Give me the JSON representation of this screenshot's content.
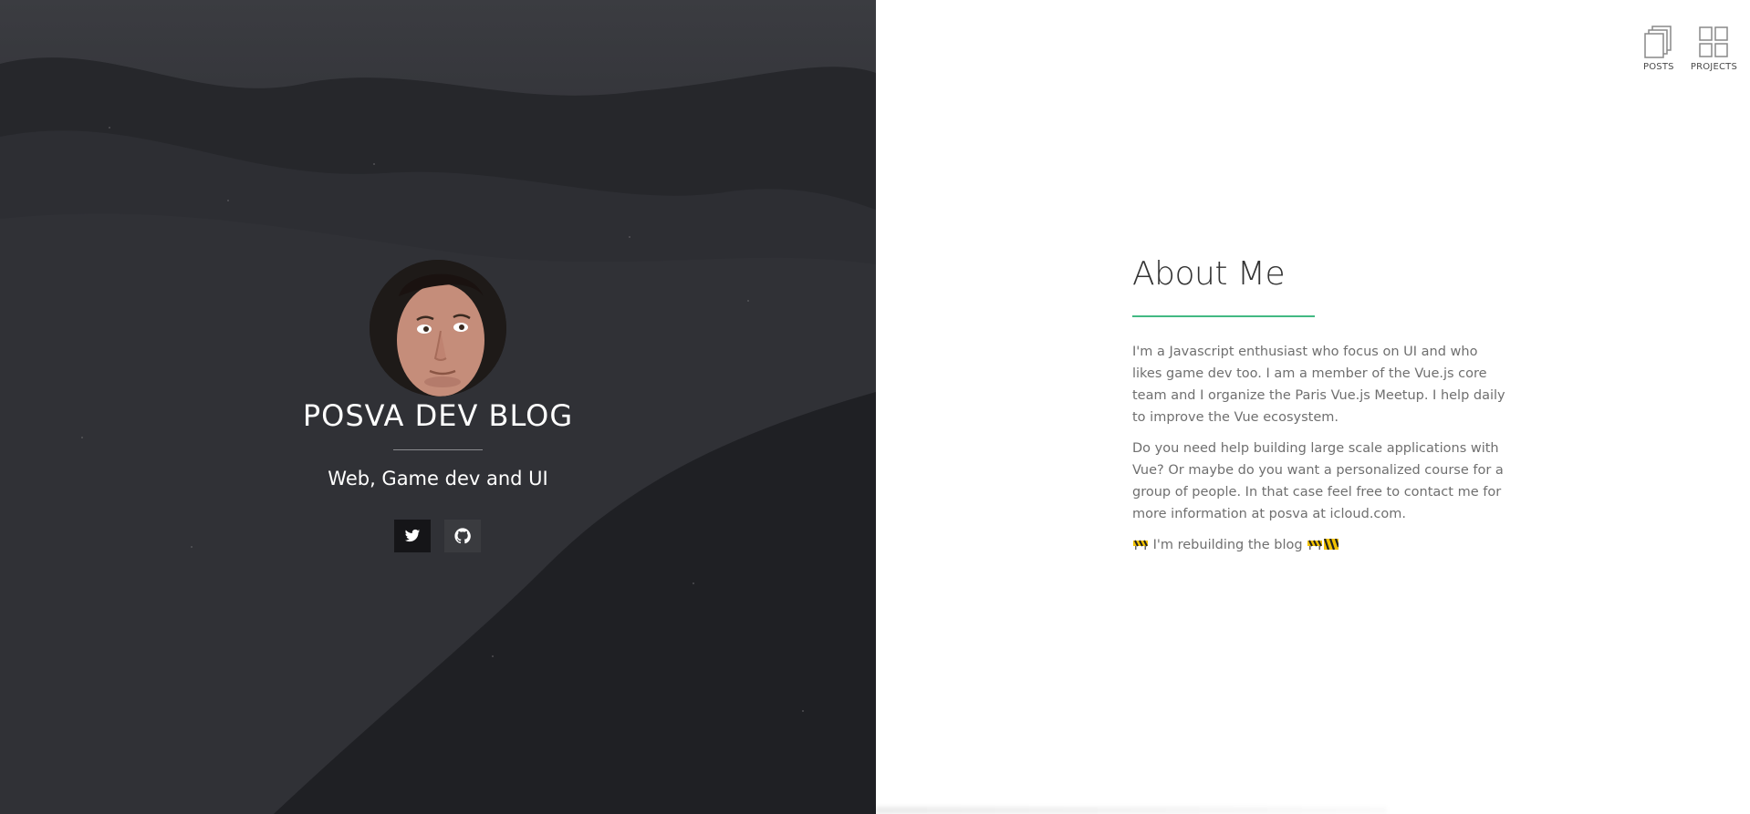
{
  "hero": {
    "title": "POSVA DEV BLOG",
    "tagline": "Web, Game dev and UI",
    "social": [
      {
        "name": "twitter",
        "icon": "twitter-icon"
      },
      {
        "name": "github",
        "icon": "github-icon"
      }
    ]
  },
  "nav": {
    "posts_label": "POSTS",
    "projects_label": "PROJECTS"
  },
  "about": {
    "heading": "About Me",
    "paragraph1": "I'm a Javascript enthusiast who focus on UI and who likes game dev too. I am a member of the Vue.js core team and I organize the Paris Vue.js Meetup. I help daily to improve the Vue ecosystem.",
    "paragraph2": "Do you need help building large scale applications with Vue? Or maybe do you want a personalized course for a group of people. In that case feel free to contact me for more information at posva at icloud.com.",
    "rebuild_text": "I'm rebuilding the blog"
  },
  "colors": {
    "accent": "#42b983",
    "hero_bg": "#2a2b30"
  }
}
